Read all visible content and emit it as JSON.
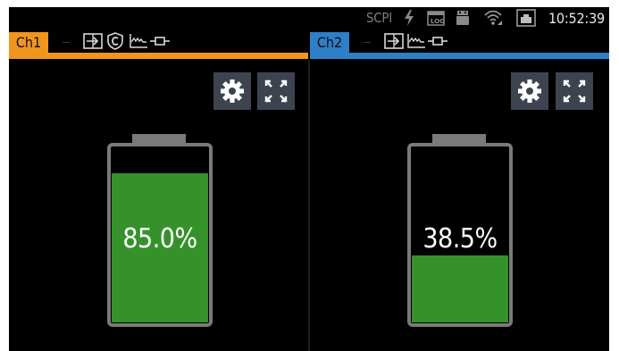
{
  "status_bar": {
    "scpi_label": "SCPI",
    "time": "10:52:39",
    "icons": [
      "lightning-icon",
      "log-icon",
      "usb-drive-icon",
      "wifi-icon",
      "ethernet-icon"
    ]
  },
  "channels": [
    {
      "label": "Ch1",
      "accent_color": "#f0961e",
      "mode_icons": [
        "output-arrow-icon",
        "protection-c-icon",
        "ramp-waveform-icon",
        "load-connector-icon"
      ],
      "battery": {
        "charge_percent": 85.0,
        "display": "85.0%"
      },
      "buttons": {
        "settings": "gear-icon",
        "fullscreen": "expand-icon"
      }
    },
    {
      "label": "Ch2",
      "accent_color": "#2f7ec8",
      "mode_icons": [
        "output-arrow-icon",
        "ramp-waveform-icon",
        "load-connector-icon"
      ],
      "battery": {
        "charge_percent": 38.5,
        "display": "38.5%"
      },
      "buttons": {
        "settings": "gear-icon",
        "fullscreen": "expand-icon"
      }
    }
  ],
  "colors": {
    "background": "#000000",
    "battery_fill": "#35922b",
    "battery_frame": "#7a7a7a",
    "button_bg": "#3d4450"
  }
}
